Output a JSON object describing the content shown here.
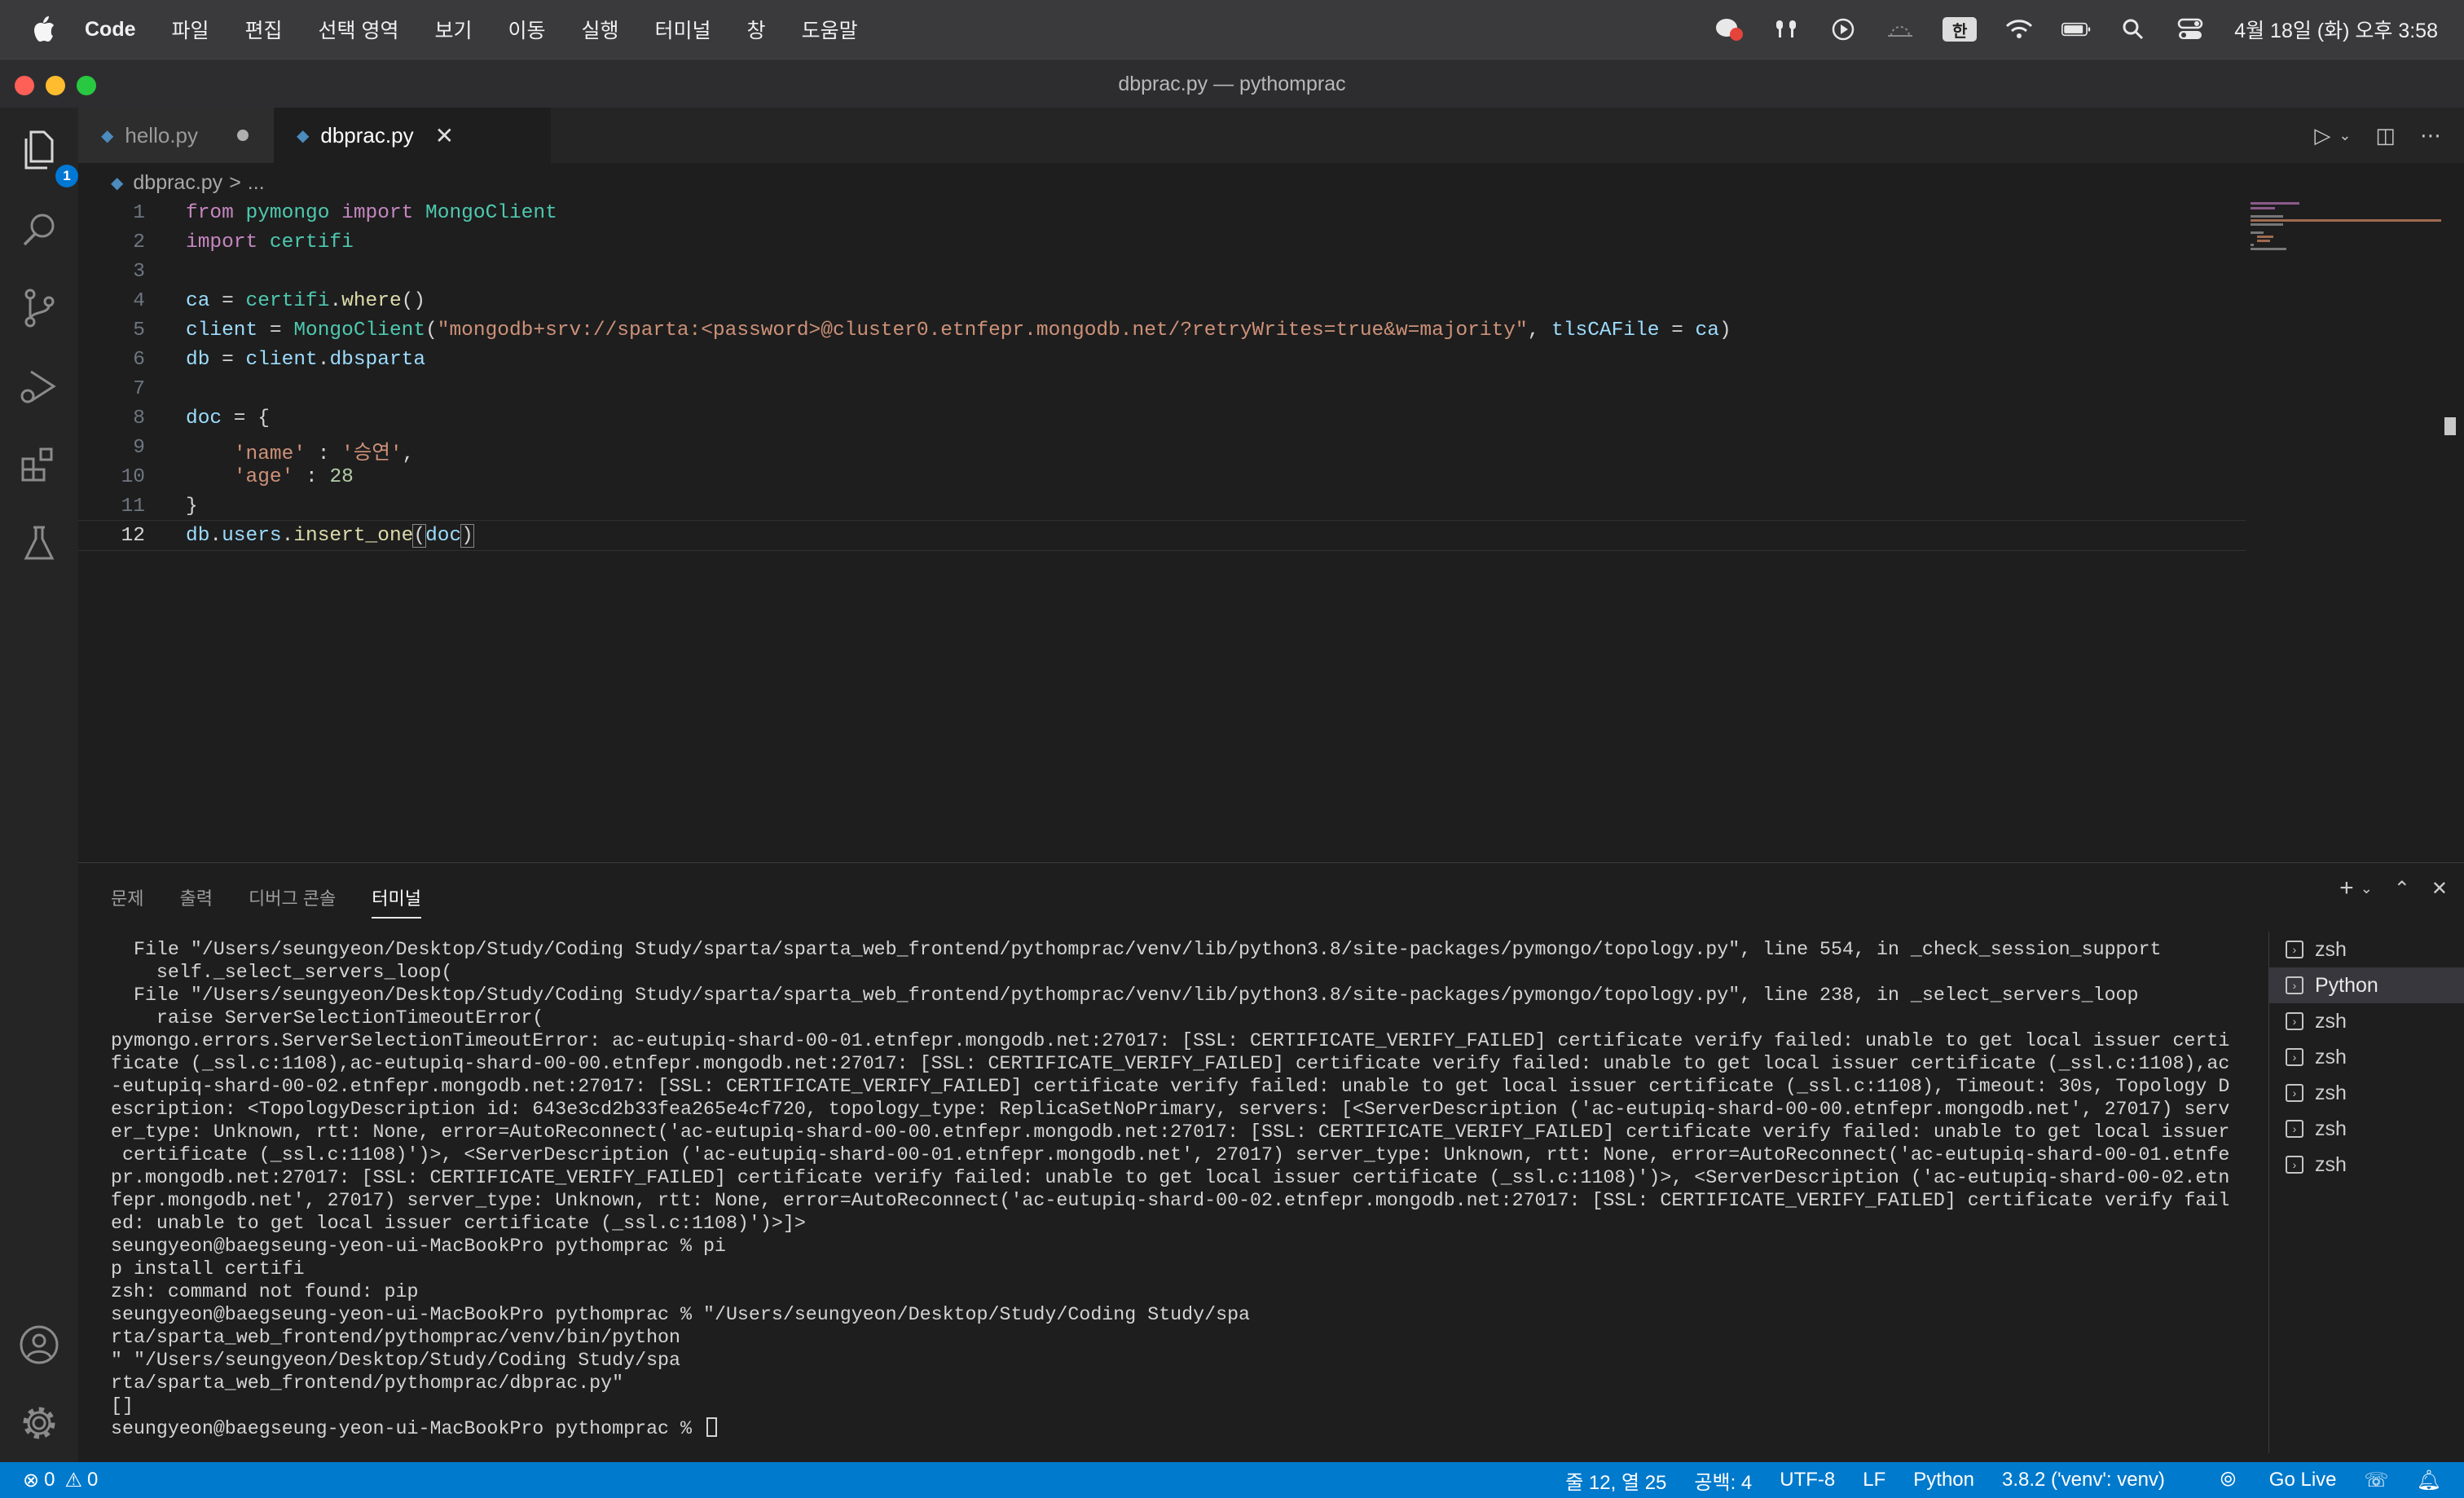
{
  "menubar": {
    "items": [
      "Code",
      "파일",
      "편집",
      "선택 영역",
      "보기",
      "이동",
      "실행",
      "터미널",
      "창",
      "도움말"
    ],
    "input_source": "한",
    "clock": "4월 18일 (화) 오후 3:58"
  },
  "window": {
    "title": "dbprac.py — pythomprac"
  },
  "activity_bar": {
    "explorer_badge": "1"
  },
  "tabs": [
    {
      "label": "hello.py",
      "modified": true
    },
    {
      "label": "dbprac.py",
      "active": true
    }
  ],
  "breadcrumb": {
    "file": "dbprac.py",
    "sep": ">",
    "rest": "..."
  },
  "editor": {
    "lines": [
      "1",
      "2",
      "3",
      "4",
      "5",
      "6",
      "7",
      "8",
      "9",
      "10",
      "11",
      "12"
    ],
    "current_line": "12",
    "tokens": {
      "l1": [
        "from",
        " pymongo ",
        "import",
        " MongoClient"
      ],
      "l2": [
        "import",
        " certifi"
      ],
      "l4": [
        "ca",
        " = ",
        "certifi",
        ".",
        "where",
        "()"
      ],
      "l5": [
        "client",
        " = ",
        "MongoClient",
        "(",
        "\"mongodb+srv://sparta:<password>@cluster0.etnfepr.mongodb.net/?retryWrites=true&w=majority\"",
        ", ",
        "tlsCAFile",
        " = ",
        "ca",
        ")"
      ],
      "l6": [
        "db",
        " = ",
        "client",
        ".",
        "dbsparta"
      ],
      "l8": [
        "doc",
        " = {"
      ],
      "l9": [
        "    ",
        "'name'",
        " : ",
        "'승연'",
        ","
      ],
      "l10": [
        "    ",
        "'age'",
        " : ",
        "28"
      ],
      "l11": [
        "}"
      ],
      "l12": [
        "db",
        ".",
        "users",
        ".",
        "insert_one",
        "(",
        "doc",
        ")"
      ]
    }
  },
  "panel": {
    "tabs": [
      "문제",
      "출력",
      "디버그 콘솔",
      "터미널"
    ],
    "active_tab": "터미널",
    "terminal_lines": [
      "  File \"/Users/seungyeon/Desktop/Study/Coding Study/sparta/sparta_web_frontend/pythomprac/venv/lib/python3.8/site-packages/pymongo/topology.py\", line 554, in _check_session_support",
      "    self._select_servers_loop(",
      "  File \"/Users/seungyeon/Desktop/Study/Coding Study/sparta/sparta_web_frontend/pythomprac/venv/lib/python3.8/site-packages/pymongo/topology.py\", line 238, in _select_servers_loop",
      "    raise ServerSelectionTimeoutError(",
      "pymongo.errors.ServerSelectionTimeoutError: ac-eutupiq-shard-00-01.etnfepr.mongodb.net:27017: [SSL: CERTIFICATE_VERIFY_FAILED] certificate verify failed: unable to get local issuer certi",
      "ficate (_ssl.c:1108),ac-eutupiq-shard-00-00.etnfepr.mongodb.net:27017: [SSL: CERTIFICATE_VERIFY_FAILED] certificate verify failed: unable to get local issuer certificate (_ssl.c:1108),ac",
      "-eutupiq-shard-00-02.etnfepr.mongodb.net:27017: [SSL: CERTIFICATE_VERIFY_FAILED] certificate verify failed: unable to get local issuer certificate (_ssl.c:1108), Timeout: 30s, Topology D",
      "escription: <TopologyDescription id: 643e3cd2b33fea265e4cf720, topology_type: ReplicaSetNoPrimary, servers: [<ServerDescription ('ac-eutupiq-shard-00-00.etnfepr.mongodb.net', 27017) serv",
      "er_type: Unknown, rtt: None, error=AutoReconnect('ac-eutupiq-shard-00-00.etnfepr.mongodb.net:27017: [SSL: CERTIFICATE_VERIFY_FAILED] certificate verify failed: unable to get local issuer",
      " certificate (_ssl.c:1108)')>, <ServerDescription ('ac-eutupiq-shard-00-01.etnfepr.mongodb.net', 27017) server_type: Unknown, rtt: None, error=AutoReconnect('ac-eutupiq-shard-00-01.etnfe",
      "pr.mongodb.net:27017: [SSL: CERTIFICATE_VERIFY_FAILED] certificate verify failed: unable to get local issuer certificate (_ssl.c:1108)')>, <ServerDescription ('ac-eutupiq-shard-00-02.etn",
      "fepr.mongodb.net', 27017) server_type: Unknown, rtt: None, error=AutoReconnect('ac-eutupiq-shard-00-02.etnfepr.mongodb.net:27017: [SSL: CERTIFICATE_VERIFY_FAILED] certificate verify fail",
      "ed: unable to get local issuer certificate (_ssl.c:1108)')>]>",
      "seungyeon@baegseung-yeon-ui-MacBookPro pythomprac % pi",
      "p install certifi",
      "zsh: command not found: pip",
      "seungyeon@baegseung-yeon-ui-MacBookPro pythomprac % \"/Users/seungyeon/Desktop/Study/Coding Study/spa",
      "rta/sparta_web_frontend/pythomprac/venv/bin/python",
      "\" \"/Users/seungyeon/Desktop/Study/Coding Study/spa",
      "rta/sparta_web_frontend/pythomprac/dbprac.py\"",
      "[]"
    ],
    "prompt": "seungyeon@baegseung-yeon-ui-MacBookPro pythomprac % ",
    "terminals": [
      "zsh",
      "Python",
      "zsh",
      "zsh",
      "zsh",
      "zsh",
      "zsh"
    ],
    "selected_terminal": "Python"
  },
  "statusbar": {
    "errors": "0",
    "warnings": "0",
    "position": "줄 12, 열 25",
    "indent": "공백: 4",
    "encoding": "UTF-8",
    "eol": "LF",
    "language": "Python",
    "interpreter": "3.8.2 ('venv': venv)",
    "golive": "Go Live"
  },
  "colors": {
    "accent": "#007acc",
    "badge": "#0078d4",
    "keyword": "#c586c0",
    "string": "#ce9178",
    "function": "#dcdcaa",
    "variable": "#9cdcfe",
    "type": "#4ec9b0",
    "number": "#b5cea8"
  }
}
